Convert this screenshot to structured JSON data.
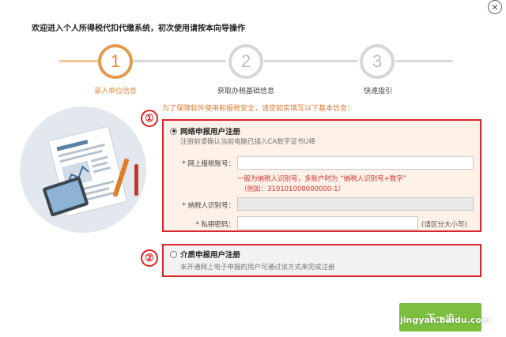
{
  "window": {
    "title": "欢迎进入个人所得税代扣代缴系统，初次使用请按本向导操作",
    "close_glyph": "✕"
  },
  "steps": [
    {
      "number": "1",
      "label": "录入单位信息",
      "state": "active"
    },
    {
      "number": "2",
      "label": "获取办税基础信息",
      "state": "inactive"
    },
    {
      "number": "3",
      "label": "快速指引",
      "state": "inactive"
    }
  ],
  "notice": "为了保障软件使用和报税安全，请您如实填写以下基本信息：",
  "markers": [
    "①",
    "②"
  ],
  "online_option": {
    "title": "网络申报用户注册",
    "subtitle": "注册前请确认当前电脑已插入CA数字证书U棒",
    "selected": true,
    "fields": {
      "account": {
        "label": "* 网上报税账号：",
        "value": ""
      },
      "account_hint_line1": "一般为纳税人识别号，多账户时为 “纳税人识别号+数字”",
      "account_hint_line2": "（例如：310101000000000-1）",
      "taxpayer_id": {
        "label": "* 纳税人识别号：",
        "value": ""
      },
      "key_password": {
        "label": "* 私钥密码：",
        "value": "",
        "hint": "(请区分大小写)"
      }
    }
  },
  "media_option": {
    "title": "介质申报用户注册",
    "subtitle": "未开通网上电子申报的用户可通过该方式来完成注册",
    "selected": false
  },
  "next_button": {
    "label": "下一步"
  },
  "watermark": {
    "text": "jingyan.baidu.com",
    "logo_text": "Baidu 经验"
  },
  "colors": {
    "accent_orange": "#e39a4f",
    "highlight_red": "#d8242a",
    "button_green": "#7cbf3e",
    "panel_bg": "#fdf1e8"
  }
}
